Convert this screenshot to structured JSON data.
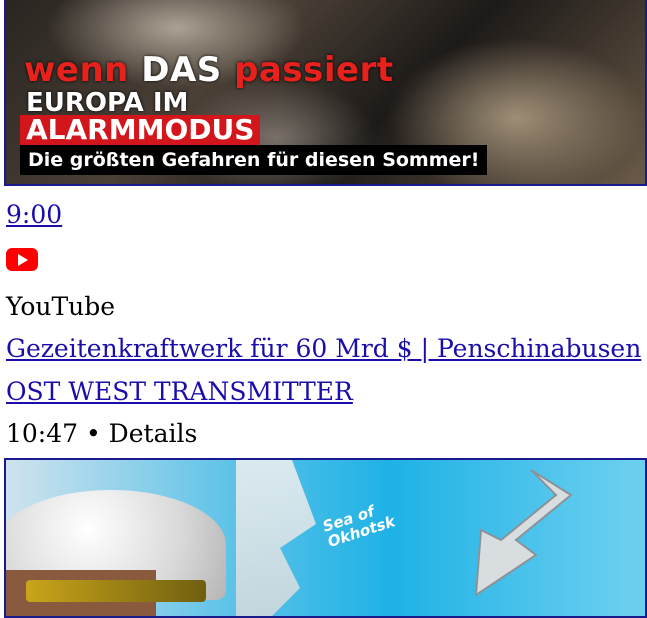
{
  "thumbnail_top": {
    "line1_red1": "wenn ",
    "line1_white": "DAS",
    "line1_red2": " passiert",
    "line2": "EUROPA IM",
    "line3": "ALARMMODUS",
    "line4": "Die größten Gefahren für diesen Sommer!"
  },
  "video": {
    "duration": "9:00",
    "source_icon": "youtube-icon",
    "source": "YouTube",
    "title": "Gezeitenkraftwerk für 60 Mrd $ | Penschinabusen",
    "channel": "OST WEST TRANSMITTER",
    "meta": "10:47 • Details"
  },
  "thumbnail_bottom": {
    "map_label_line1": "Sea of",
    "map_label_line2": "Okhotsk"
  },
  "colors": {
    "link": "#1a0dab",
    "youtube_red": "#ff0000",
    "alarm_red": "#d3161b"
  }
}
